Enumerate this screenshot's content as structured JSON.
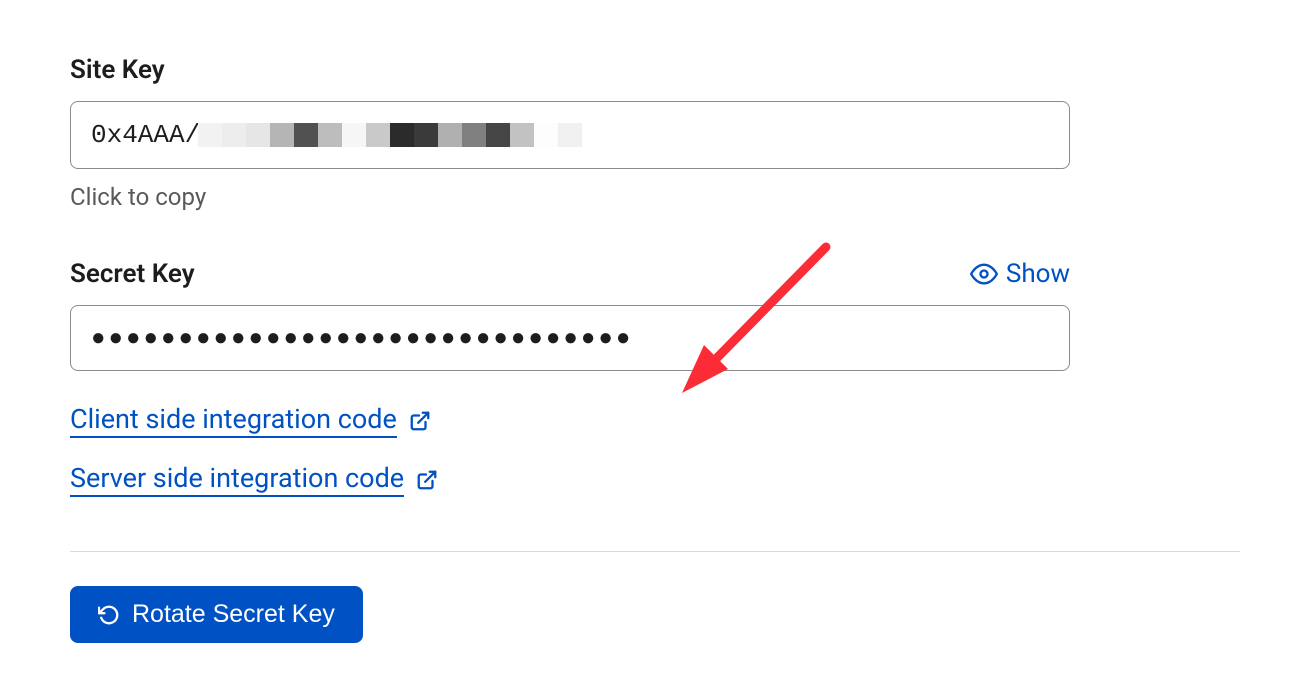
{
  "siteKey": {
    "label": "Site Key",
    "valuePrefix": "0x4AAA",
    "helper": "Click to copy"
  },
  "secretKey": {
    "label": "Secret Key",
    "showLabel": "Show",
    "maskedValue": "●●●●●●●●●●●●●●●●●●●●●●●●●●●●●●●"
  },
  "links": {
    "client": "Client side integration code",
    "server": "Server side integration code"
  },
  "rotateButton": "Rotate Secret Key",
  "colors": {
    "link": "#0051c3",
    "primaryButton": "#0051c3",
    "annotationArrow": "#fb2c36"
  }
}
